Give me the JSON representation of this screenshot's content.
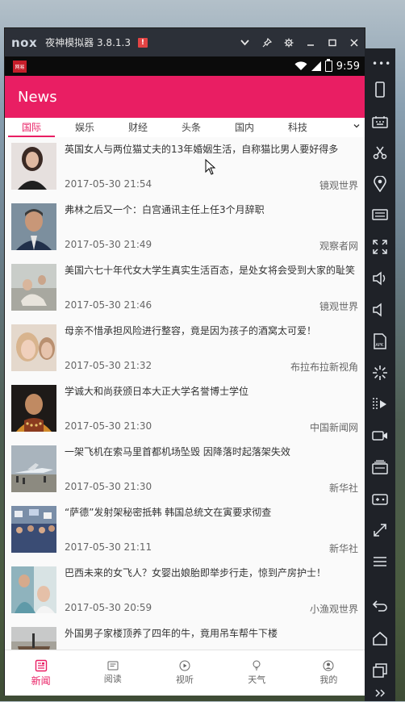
{
  "emulator": {
    "logo": "nox",
    "title": "夜神模拟器 3.8.1.3",
    "warning_badge": "!",
    "titlebar_icons": [
      "chevron-down-icon",
      "pin-icon",
      "gear-icon",
      "minimize-icon",
      "maximize-icon",
      "close-icon"
    ]
  },
  "statusbar": {
    "app_icon_text": "网易",
    "time": "9:59"
  },
  "appbar": {
    "title": "News"
  },
  "tabs": [
    "国际",
    "娱乐",
    "财经",
    "头条",
    "国内",
    "科技"
  ],
  "active_tab": "国际",
  "news": [
    {
      "title": "英国女人与两位猫丈夫的13年婚姻生活，自称猫比男人要好得多",
      "time": "2017-05-30 21:54",
      "source": "镜观世界"
    },
    {
      "title": "弗林之后又一个：白宫通讯主任上任3个月辞职",
      "time": "2017-05-30 21:49",
      "source": "观察者网"
    },
    {
      "title": "美国六七十年代女大学生真实生活百态，是处女将会受到大家的耻笑",
      "time": "2017-05-30 21:46",
      "source": "镜观世界"
    },
    {
      "title": "母亲不惜承担风险进行整容，竟是因为孩子的酒窝太可爱！",
      "time": "2017-05-30 21:32",
      "source": "布拉布拉新视角"
    },
    {
      "title": "学诚大和尚获颁日本大正大学名誉博士学位",
      "time": "2017-05-30 21:30",
      "source": "中国新闻网"
    },
    {
      "title": "一架飞机在索马里首都机场坠毁 因降落时起落架失效",
      "time": "2017-05-30 21:30",
      "source": "新华社"
    },
    {
      "title": "“萨德”发射架秘密抵韩 韩国总统文在寅要求彻查",
      "time": "2017-05-30 21:11",
      "source": "新华社"
    },
    {
      "title": "巴西未来的女飞人？女婴出娘胎即举步行走，惊到产房护士！",
      "time": "2017-05-30 20:59",
      "source": "小渔观世界"
    },
    {
      "title": "外国男子家楼顶养了四年的牛，竟用吊车帮牛下楼",
      "time": "",
      "source": ""
    }
  ],
  "bottomnav": [
    {
      "label": "新闻",
      "icon": "news-icon"
    },
    {
      "label": "阅读",
      "icon": "reading-icon"
    },
    {
      "label": "视听",
      "icon": "play-icon"
    },
    {
      "label": "天气",
      "icon": "weather-icon"
    },
    {
      "label": "我的",
      "icon": "profile-icon"
    }
  ],
  "colors": {
    "accent": "#e91e63",
    "titlebar": "#2c3038",
    "sidebar": "#1f2228"
  }
}
